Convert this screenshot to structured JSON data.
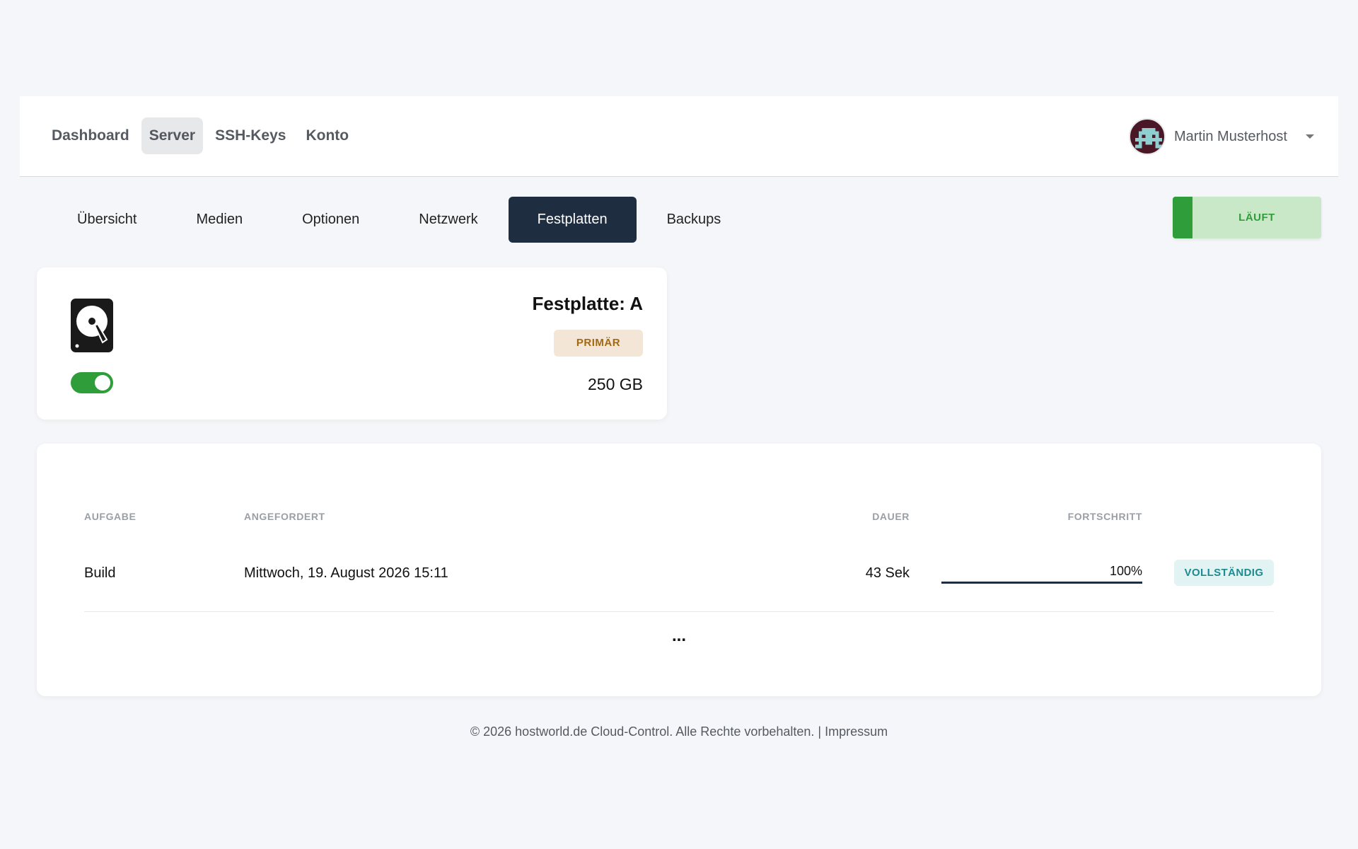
{
  "nav": {
    "items": [
      {
        "label": "Dashboard",
        "active": false
      },
      {
        "label": "Server",
        "active": true
      },
      {
        "label": "SSH-Keys",
        "active": false
      },
      {
        "label": "Konto",
        "active": false
      }
    ]
  },
  "user": {
    "name": "Martin Musterhost",
    "avatar_icon": "pixel-avatar-icon"
  },
  "tabs": [
    {
      "label": "Übersicht",
      "active": false
    },
    {
      "label": "Medien",
      "active": false
    },
    {
      "label": "Optionen",
      "active": false
    },
    {
      "label": "Netzwerk",
      "active": false
    },
    {
      "label": "Festplatten",
      "active": true
    },
    {
      "label": "Backups",
      "active": false
    }
  ],
  "status": {
    "label": "LÄUFT",
    "color": "#2f9e3a"
  },
  "disk": {
    "title": "Festplatte: A",
    "badge": "PRIMÄR",
    "size": "250 GB",
    "enabled": true,
    "icon": "hard-drive-icon"
  },
  "tasks": {
    "columns": {
      "task": "AUFGABE",
      "requested": "ANGEFORDERT",
      "duration": "DAUER",
      "progress": "FORTSCHRITT"
    },
    "rows": [
      {
        "task": "Build",
        "requested": "Mittwoch, 19. August 2026 15:11",
        "duration": "43 Sek",
        "progress_text": "100%",
        "progress": 1.0,
        "status": "VOLLSTÄNDIG"
      }
    ],
    "more": "..."
  },
  "footer": {
    "text": "© 2026 hostworld.de Cloud-Control. Alle Rechte vorbehalten. |",
    "link": "Impressum"
  },
  "colors": {
    "accent_dark": "#1f2d40",
    "success": "#2f9e3a",
    "primary_badge": "#a06a14",
    "complete_badge": "#1e8a8f"
  }
}
